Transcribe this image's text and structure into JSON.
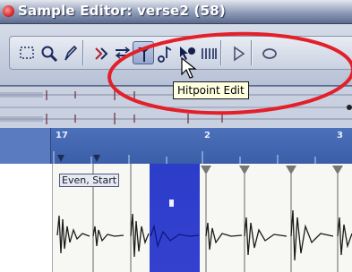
{
  "window": {
    "title": "Sample Editor: verse2 (58)"
  },
  "toolbar": {
    "tools": [
      {
        "name": "range-selection-icon"
      },
      {
        "name": "zoom-icon"
      },
      {
        "name": "pencil-icon"
      },
      {
        "name": "play-icon"
      },
      {
        "name": "scrub-icon"
      },
      {
        "name": "hitpoint-edit-icon",
        "active": true
      },
      {
        "name": "audition-icon"
      },
      {
        "name": "draw-hitpoint-icon"
      },
      {
        "name": "warp-icon"
      },
      {
        "name": "loop-play-icon"
      }
    ],
    "tooltip": "Hitpoint Edit"
  },
  "ruler": {
    "marks": [
      "17",
      "2",
      "3"
    ]
  },
  "waveform": {
    "slice_label": "Even, Start"
  },
  "colors": {
    "selection": "#2c3dca",
    "ruler": "#4466b0",
    "annotation": "#e3202a"
  }
}
